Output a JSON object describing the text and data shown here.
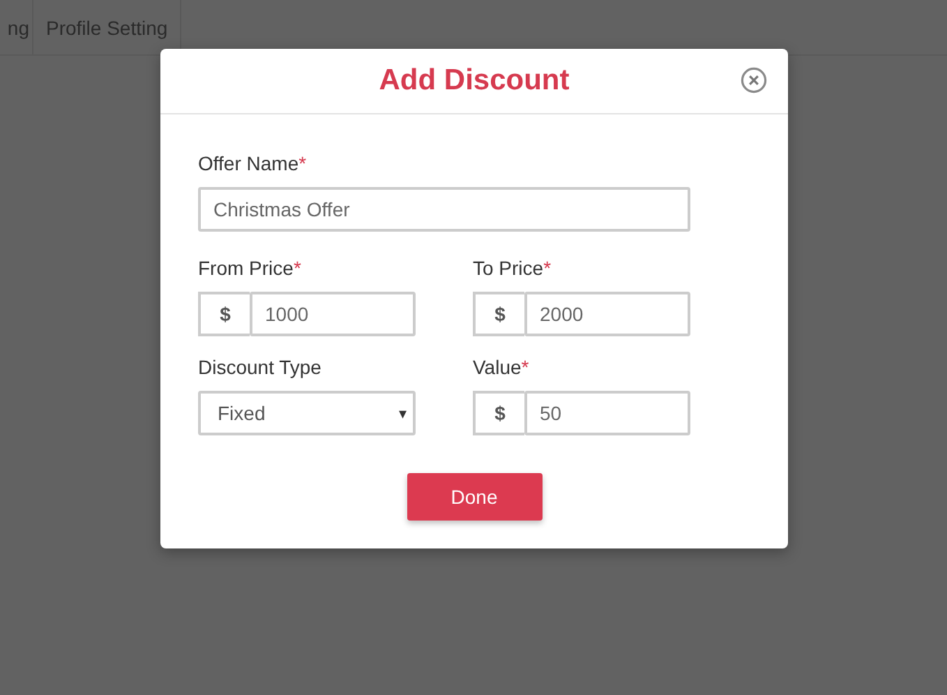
{
  "nav_tabs": [
    {
      "label": "ng"
    },
    {
      "label": "Profile Setting"
    }
  ],
  "dialog": {
    "title": "Add Discount",
    "fields": [
      {
        "kind": "text",
        "label": "Offer Name",
        "mark": "*",
        "value": "Christmas Offer"
      },
      {
        "kind": "currency",
        "label": "From Price",
        "mark": "*",
        "prefix": "$",
        "value": "1000"
      },
      {
        "kind": "currency",
        "label": "To Price",
        "mark": "*",
        "prefix": "$",
        "value": "2000"
      },
      {
        "kind": "select",
        "label": "Discount Type",
        "value": "Fixed",
        "caret": "▾"
      },
      {
        "kind": "currency",
        "label": "Value",
        "mark": "*",
        "prefix": "$",
        "value": "50"
      }
    ],
    "button": "Done"
  }
}
